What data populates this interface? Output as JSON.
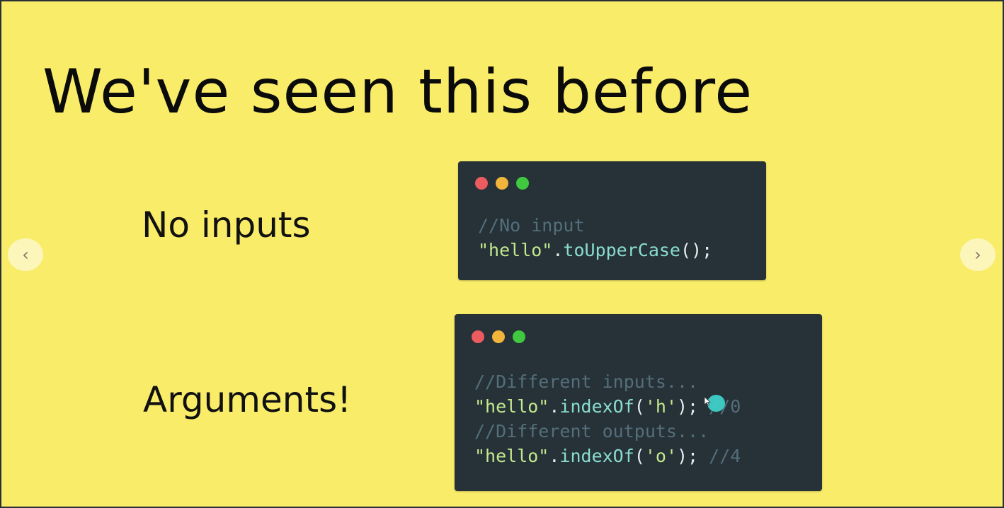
{
  "slide": {
    "title": "We've seen this before",
    "background_color": "#f9ec69"
  },
  "sections": [
    {
      "label": "No inputs",
      "code_lines": [
        [
          {
            "t": "//No input",
            "c": "cmt"
          }
        ],
        [
          {
            "t": "\"hello\"",
            "c": "str"
          },
          {
            "t": ".",
            "c": "pun"
          },
          {
            "t": "toUpperCase",
            "c": "fn"
          },
          {
            "t": "();",
            "c": "pun"
          }
        ]
      ]
    },
    {
      "label": "Arguments!",
      "code_lines": [
        [
          {
            "t": "//Different inputs...",
            "c": "cmt"
          }
        ],
        [
          {
            "t": "\"hello\"",
            "c": "str"
          },
          {
            "t": ".",
            "c": "pun"
          },
          {
            "t": "indexOf",
            "c": "fn"
          },
          {
            "t": "(",
            "c": "pun"
          },
          {
            "t": "'h'",
            "c": "str"
          },
          {
            "t": "); ",
            "c": "pun"
          },
          {
            "t": "//0",
            "c": "cmt"
          }
        ],
        [
          {
            "t": "//Different outputs...",
            "c": "cmt"
          }
        ],
        [
          {
            "t": "\"hello\"",
            "c": "str"
          },
          {
            "t": ".",
            "c": "pun"
          },
          {
            "t": "indexOf",
            "c": "fn"
          },
          {
            "t": "(",
            "c": "pun"
          },
          {
            "t": "'o'",
            "c": "str"
          },
          {
            "t": "); ",
            "c": "pun"
          },
          {
            "t": "//4",
            "c": "cmt"
          }
        ]
      ]
    }
  ],
  "window_dot_colors": [
    "#ec5b5f",
    "#f1b53b",
    "#40c840"
  ],
  "navigation": {
    "prev_icon": "chevron-left-icon",
    "prev_glyph": "‹",
    "next_icon": "chevron-right-icon",
    "next_glyph": "›"
  }
}
